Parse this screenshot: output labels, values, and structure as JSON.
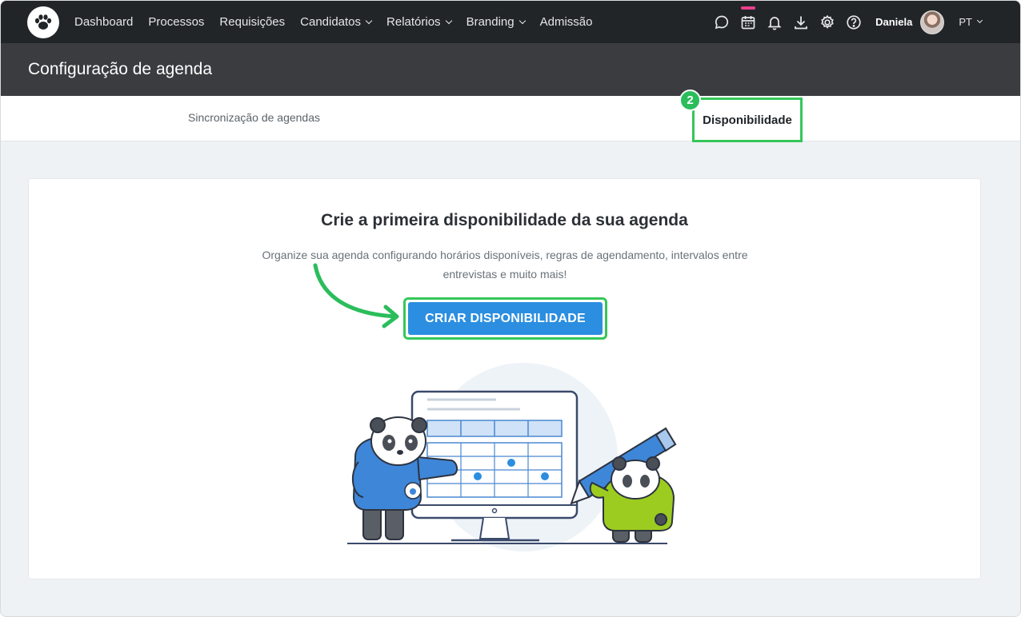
{
  "nav": {
    "links": [
      {
        "label": "Dashboard",
        "dropdown": false
      },
      {
        "label": "Processos",
        "dropdown": false
      },
      {
        "label": "Requisições",
        "dropdown": false
      },
      {
        "label": "Candidatos",
        "dropdown": true
      },
      {
        "label": "Relatórios",
        "dropdown": true
      },
      {
        "label": "Branding",
        "dropdown": true
      },
      {
        "label": "Admissão",
        "dropdown": false
      }
    ],
    "icons": [
      "chat-icon",
      "calendar-icon",
      "bell-icon",
      "download-icon",
      "gear-icon",
      "help-icon"
    ],
    "user_name": "Daniela",
    "language": "PT"
  },
  "header": {
    "title": "Configuração de agenda"
  },
  "tabs": {
    "sync": "Sincronização de agendas",
    "availability": "Disponibilidade",
    "step_number": "2"
  },
  "card": {
    "title": "Crie a primeira disponibilidade da sua agenda",
    "description": "Organize sua agenda configurando horários disponíveis, regras de agendamento, intervalos entre entrevistas e muito mais!",
    "cta_label": "CRIAR DISPONIBILIDADE"
  },
  "colors": {
    "nav_bg": "#222528",
    "header_bg": "#3a3c3f",
    "highlight": "#34c759",
    "primary": "#2b8ee0"
  }
}
